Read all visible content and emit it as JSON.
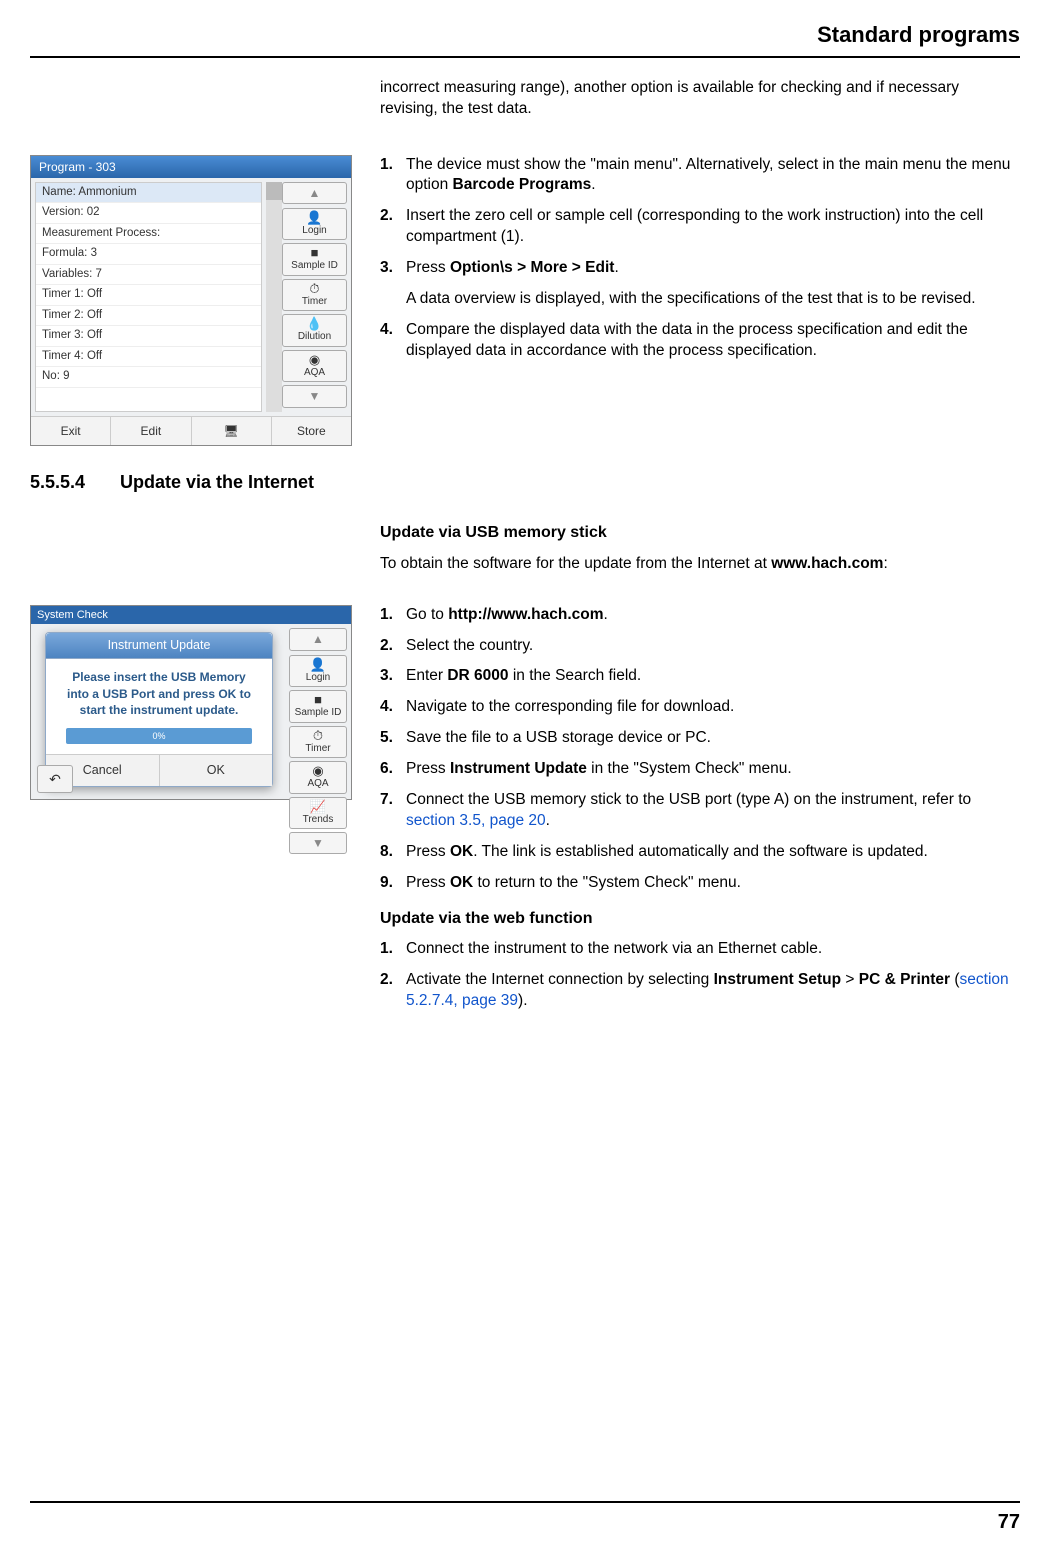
{
  "header": {
    "title": "Standard programs"
  },
  "intro_fragment": "incorrect measuring range), another option is available for checking and if necessary revising, the test data.",
  "shot1": {
    "title": "Program - 303",
    "rows": [
      "Name: Ammonium",
      "Version: 02",
      "Measurement Process:",
      "Formula: 3",
      "Variables: 7",
      "Timer 1: Off",
      "Timer 2: Off",
      "Timer 3: Off",
      "Timer 4: Off",
      "No: 9"
    ],
    "side": [
      "Login",
      "Sample ID",
      "Timer",
      "Dilution",
      "AQA"
    ],
    "bottom": [
      "Exit",
      "Edit",
      "",
      "Store"
    ]
  },
  "steps_block1": [
    {
      "n": "1.",
      "html": "The device must show the \"main menu\". Alternatively, select in the main menu the menu option <span class=\"bold\">Barcode Programs</span>."
    },
    {
      "n": "2.",
      "html": "Insert the zero cell or sample cell (corresponding to the work instruction) into the cell compartment (1)."
    },
    {
      "n": "3.",
      "html": "Press <span class=\"bold\">Option\\s &gt; More &gt; Edit</span>.",
      "after": "A data overview is displayed, with the specifications of the test that is to be revised."
    },
    {
      "n": "4.",
      "html": "Compare the displayed data with the data in the process specification and edit the displayed data in accordance with the process specification."
    }
  ],
  "section": {
    "num": "5.5.5.4",
    "title": "Update via the Internet"
  },
  "usb_heading": "Update via USB memory stick",
  "usb_intro_pre": "To obtain the software for the update from the Internet at ",
  "usb_intro_bold": "www.hach.com",
  "usb_intro_post": ":",
  "shot2": {
    "top": "System Check",
    "modal_title": "Instrument Update",
    "modal_msg": "Please insert the USB Memory into a USB Port and press OK to start the instrument update.",
    "progress": "0%",
    "btn_cancel": "Cancel",
    "btn_ok": "OK",
    "side": [
      "Login",
      "Sample ID",
      "Timer",
      "AQA",
      "Trends"
    ]
  },
  "steps_block2": [
    {
      "n": "1.",
      "html": "Go to <span class=\"bold\">http://www.hach.com</span>."
    },
    {
      "n": "2.",
      "html": "Select the country."
    },
    {
      "n": "3.",
      "html": "Enter <span class=\"bold\">DR 6000</span> in the Search field."
    },
    {
      "n": "4.",
      "html": "Navigate to the corresponding file for download."
    },
    {
      "n": "5.",
      "html": "Save the file to a USB storage device or PC."
    },
    {
      "n": "6.",
      "html": "Press <span class=\"bold\">Instrument Update</span> in the \"System Check\" menu."
    },
    {
      "n": "7.",
      "html": "Connect the USB memory stick to the USB port (type  A) on the instrument, refer to <span class=\"link\">section 3.5, page 20</span>."
    },
    {
      "n": "8.",
      "html": "Press <span class=\"bold\">OK</span>. The link is established automatically and the software is updated."
    },
    {
      "n": "9.",
      "html": "Press <span class=\"bold\">OK</span> to return to the \"System Check\" menu."
    }
  ],
  "web_heading": "Update via the web function",
  "steps_block3": [
    {
      "n": "1.",
      "html": "Connect the instrument to the network via an Ethernet cable."
    },
    {
      "n": "2.",
      "html": "Activate the Internet connection by selecting <span class=\"bold\">Instrument Setup</span> &gt; <span class=\"bold\">PC &amp; Printer</span> (<span class=\"link\">section 5.2.7.4, page 39</span>)."
    }
  ],
  "page_number": "77"
}
